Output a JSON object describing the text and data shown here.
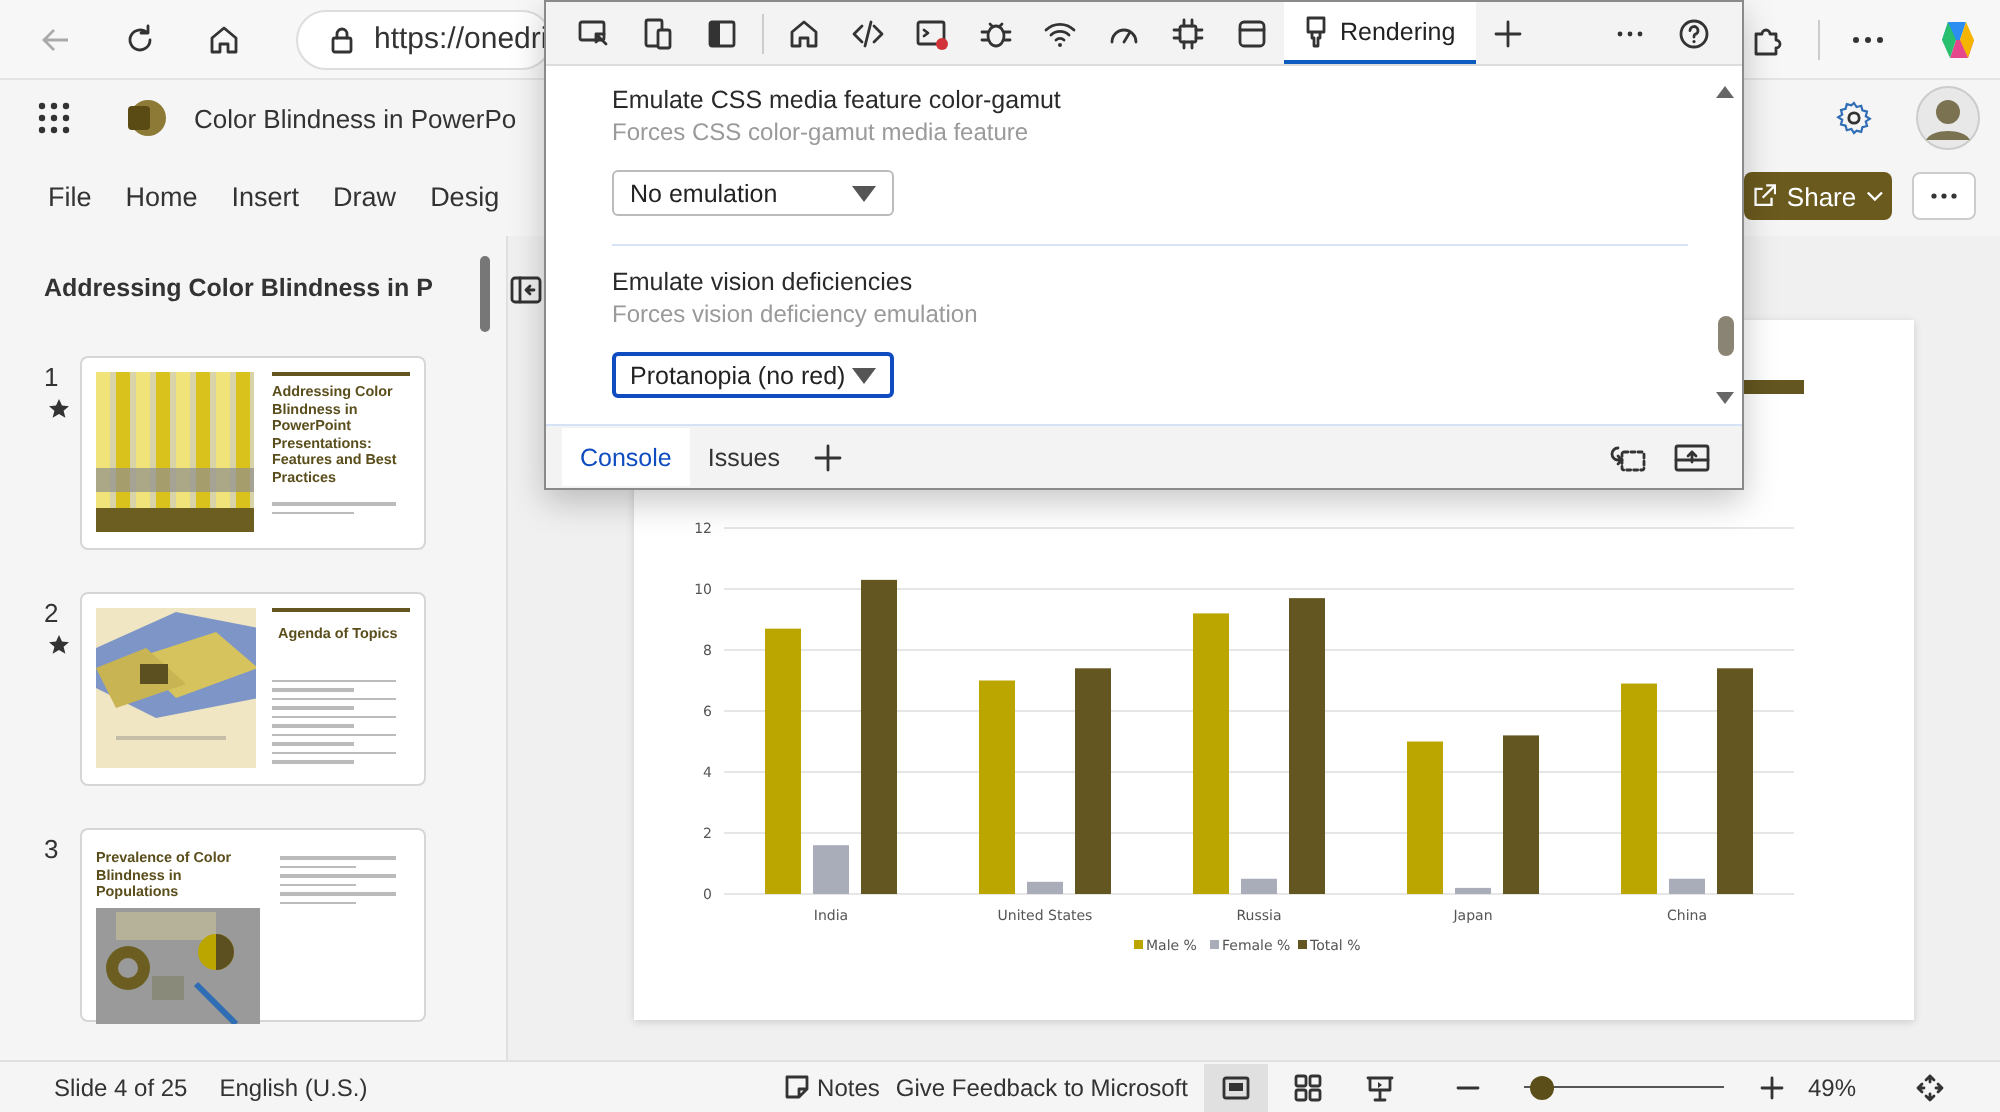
{
  "browser": {
    "url": "https://onedri"
  },
  "devtools": {
    "tabs": [
      {
        "label": "Rendering",
        "selected": true
      }
    ],
    "settings": [
      {
        "title": "Emulate CSS media feature color-gamut",
        "description": "Forces CSS color-gamut media feature",
        "value": "No emulation",
        "focused": false
      },
      {
        "title": "Emulate vision deficiencies",
        "description": "Forces vision deficiency emulation",
        "value": "Protanopia (no red)",
        "focused": true
      }
    ],
    "drawer_tabs": [
      {
        "label": "Console",
        "selected": true
      },
      {
        "label": "Issues",
        "selected": false
      }
    ]
  },
  "app": {
    "title": "Color Blindness in PowerPo",
    "menu": [
      "File",
      "Home",
      "Insert",
      "Draw",
      "Desig"
    ],
    "share": "Share"
  },
  "slides_panel": {
    "title": "Addressing Color Blindness in P",
    "slides": [
      {
        "number": "1",
        "starred": true,
        "kind": "title-image",
        "title": "Addressing Color Blindness in PowerPoint Presentations: Features and Best Practices"
      },
      {
        "number": "2",
        "starred": true,
        "kind": "bullets-image",
        "title": "Agenda of Topics"
      },
      {
        "number": "3",
        "starred": false,
        "kind": "image-below",
        "title": "Prevalence of Color Blindness in Populations"
      }
    ]
  },
  "editor": {
    "chart_data": {
      "type": "bar",
      "categories": [
        "India",
        "United States",
        "Russia",
        "Japan",
        "China"
      ],
      "series": [
        {
          "name": "Male %",
          "color": "#bba600",
          "values": [
            8.7,
            7.0,
            9.2,
            5.0,
            6.9
          ]
        },
        {
          "name": "Female %",
          "color": "#a9adba",
          "values": [
            1.6,
            0.4,
            0.5,
            0.2,
            0.5
          ]
        },
        {
          "name": "Total %",
          "color": "#635620",
          "values": [
            10.3,
            7.4,
            9.7,
            5.2,
            7.4
          ]
        }
      ],
      "ylim": [
        0,
        12
      ],
      "yticks": [
        0,
        2,
        4,
        6,
        8,
        10,
        12
      ],
      "grid": true,
      "legend": true
    }
  },
  "status_bar": {
    "slide_info": "Slide 4 of 25",
    "language": "English (U.S.)",
    "notes": "Notes",
    "feedback": "Give Feedback to Microsoft",
    "views": [
      {
        "kind": "normal",
        "selected": true
      },
      {
        "kind": "sorter",
        "selected": false
      },
      {
        "kind": "presenter",
        "selected": false
      }
    ],
    "zoom": {
      "level": 0.09,
      "reading": "49%"
    }
  }
}
